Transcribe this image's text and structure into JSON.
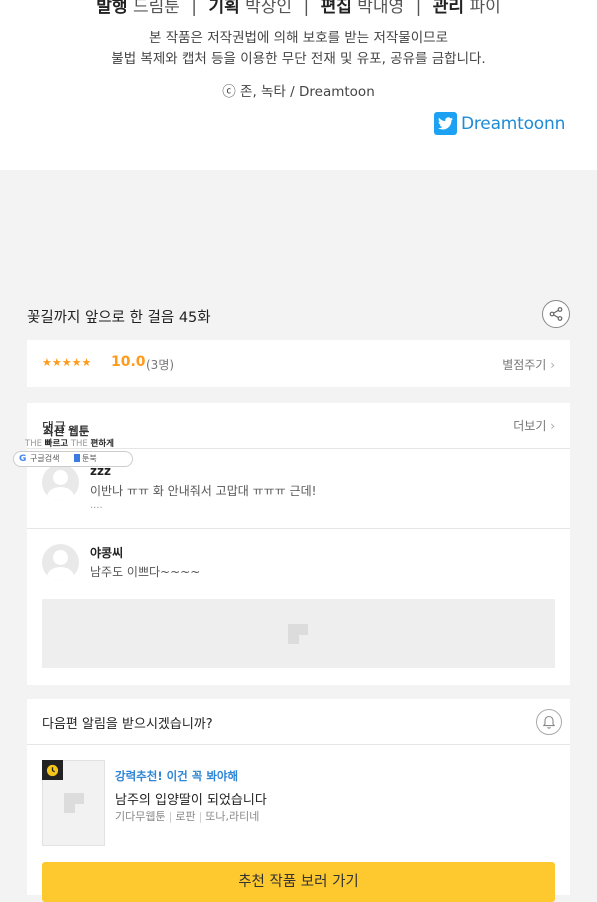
{
  "credits": {
    "publish_label": "발행",
    "publish_value": "드림툰",
    "plan_label": "기획",
    "plan_value": "박상인",
    "edit_label": "편집",
    "edit_value": "박내영",
    "manage_label": "관리",
    "manage_value": "파이"
  },
  "notice": {
    "line1": "본 작품은 저작권법에 의해 보호를 받는 저작물이므로",
    "line2": "불법 복제와 캡처 등을 이용한 무단 전재 및 유포, 공유를 금합니다.",
    "copyright": "ⓒ 존, 녹타 / Dreamtoon"
  },
  "brand": {
    "name": "Dreamtoonn",
    "icon": "twitter-bird-icon",
    "color": "#1da1f2"
  },
  "episode": {
    "title": "꽃길까지 앞으로 한 걸음 45화",
    "share_icon": "share-icon"
  },
  "rating": {
    "stars": "★★★★★",
    "score": "10.0",
    "count": "(3명)",
    "rate_button": "별점주기",
    "accent": "#ff9a1a"
  },
  "comments": {
    "title": "댓글",
    "more": "더보기",
    "items": [
      {
        "name": "zzz",
        "text": "이반나 ㅠㅠ 화 안내줘서 고맙대 ㅠㅠㅠ 근데!",
        "dots": "...."
      },
      {
        "name": "야콩씨",
        "text": "남주도 이쁘다~~~~"
      }
    ]
  },
  "overlay": {
    "title": "최신 웹툰",
    "sub_prefix": "THE",
    "sub_fast": "빠르고",
    "sub_the": "THE",
    "sub_easy": "편하게",
    "pill_google": "G",
    "pill_search": "구글검색",
    "pill_app": "툰북"
  },
  "notify": {
    "title": "다음편 알림을 받으시겠습니까?",
    "bell_icon": "bell-icon",
    "rec_tag": "강력추천! 이건 꼭 봐야해",
    "rec_title": "남주의 입양딸이 되었습니다",
    "rec_meta": [
      "기다무웹툰",
      "로판",
      "또나,라티네"
    ],
    "cta": "추천 작품 보러 가기",
    "cta_color": "#fdc92f",
    "link_color": "#2f86d6"
  }
}
